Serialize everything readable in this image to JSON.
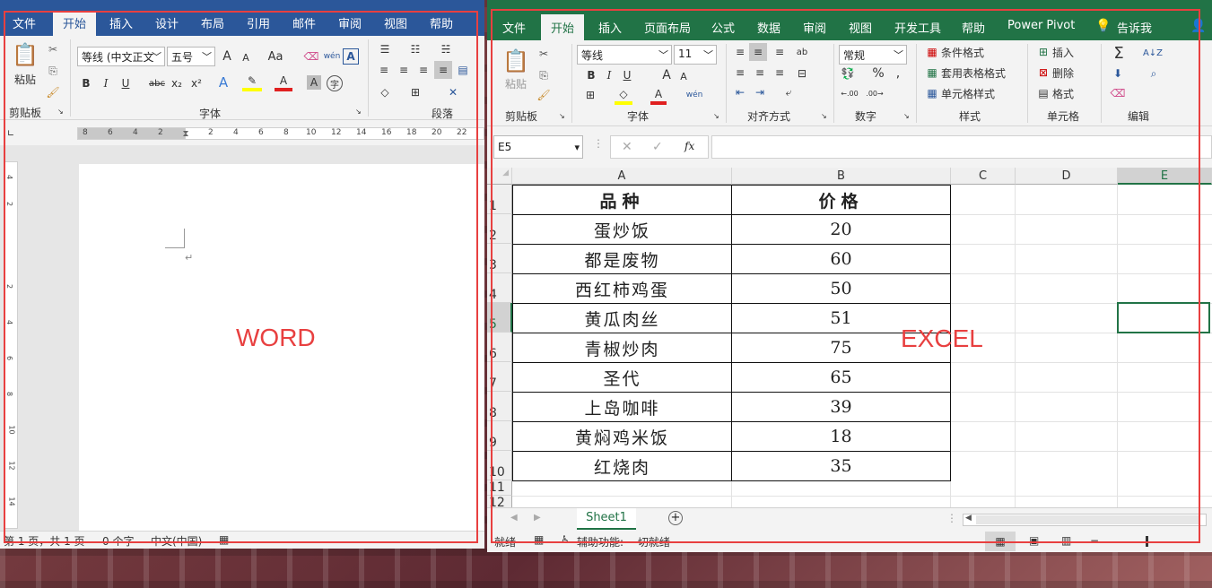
{
  "word": {
    "tabs": [
      "文件",
      "开始",
      "插入",
      "设计",
      "布局",
      "引用",
      "邮件",
      "审阅",
      "视图",
      "帮助"
    ],
    "active_tab": "开始",
    "ribbon": {
      "paste_label": "粘贴",
      "clipboard_group": "剪贴板",
      "font_group": "字体",
      "paragraph_group": "段落",
      "font_name": "等线 (中文正文",
      "font_size": "五号",
      "grow_font": "A",
      "shrink_font": "A",
      "change_case": "Aa",
      "phonetic": "wén",
      "bold": "B",
      "italic": "I",
      "underline": "U",
      "strikethrough": "abc",
      "subscript": "x₂",
      "superscript": "x²"
    },
    "ruler_numbers": [
      "8",
      "6",
      "4",
      "2",
      "2",
      "4",
      "6",
      "8",
      "10",
      "12",
      "14",
      "16",
      "18",
      "20",
      "22"
    ],
    "vruler_numbers": [
      "4",
      "2",
      "2",
      "4",
      "6",
      "8",
      "10",
      "12",
      "14"
    ],
    "status": {
      "page": "第 1 页，共 1 页",
      "words": "0 个字",
      "language": "中文(中国)"
    },
    "label": "WORD"
  },
  "excel": {
    "tabs": [
      "文件",
      "开始",
      "插入",
      "页面布局",
      "公式",
      "数据",
      "审阅",
      "视图",
      "开发工具",
      "帮助",
      "Power Pivot",
      "告诉我"
    ],
    "active_tab": "开始",
    "ribbon": {
      "paste_label": "粘贴",
      "clipboard_group": "剪贴板",
      "font_group": "字体",
      "align_group": "对齐方式",
      "number_group": "数字",
      "styles_group": "样式",
      "cells_group": "单元格",
      "edit_group": "编辑",
      "font_name": "等线",
      "font_size": "11",
      "number_format": "常规",
      "cond_format": "条件格式",
      "table_format": "套用表格格式",
      "cell_style": "单元格样式",
      "insert": "插入",
      "delete": "删除",
      "format": "格式",
      "bold": "B",
      "italic": "I",
      "underline": "U",
      "percent": "%",
      "comma": ","
    },
    "name_box": "E5",
    "formula": "",
    "fx": "fx",
    "columns": [
      "A",
      "B",
      "C",
      "D",
      "E"
    ],
    "rows": [
      "1",
      "2",
      "3",
      "4",
      "5",
      "6",
      "7",
      "8",
      "9",
      "10",
      "11",
      "12"
    ],
    "table": {
      "headers": [
        "品种",
        "价格"
      ],
      "rows": [
        [
          "蛋炒饭",
          "20"
        ],
        [
          "都是废物",
          "60"
        ],
        [
          "西红柿鸡蛋",
          "50"
        ],
        [
          "黄瓜肉丝",
          "51"
        ],
        [
          "青椒炒肉",
          "75"
        ],
        [
          "圣代",
          "65"
        ],
        [
          "上岛咖啡",
          "39"
        ],
        [
          "黄焖鸡米饭",
          "18"
        ],
        [
          "红烧肉",
          "35"
        ]
      ]
    },
    "sheet_tab": "Sheet1",
    "status": {
      "ready": "就绪",
      "accessibility": "辅助功能: 一切就绪"
    },
    "label": "EXCEL",
    "accent": "#217346"
  },
  "colors": {
    "word_accent": "#2b579a",
    "annotation": "#e84040"
  }
}
